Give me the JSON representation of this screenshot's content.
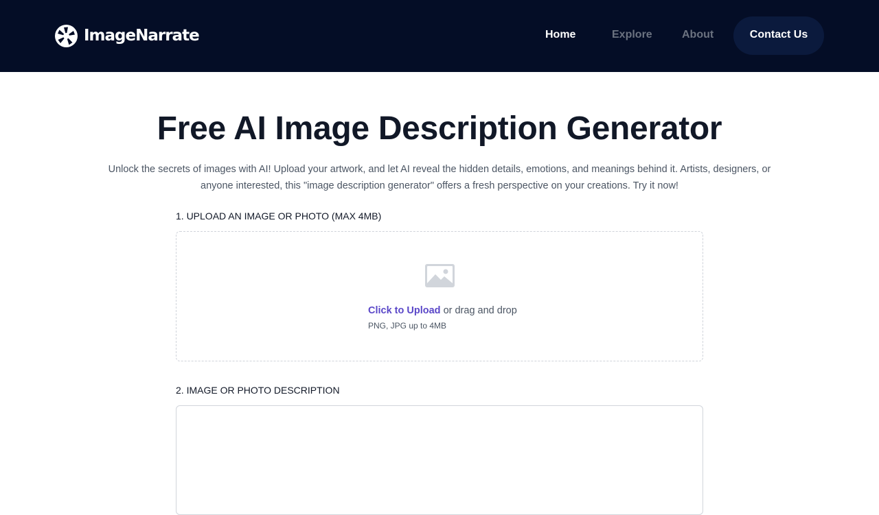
{
  "header": {
    "brand": "ImageNarrate",
    "nav": {
      "home": "Home",
      "explore": "Explore",
      "about": "About",
      "contact": "Contact Us"
    }
  },
  "main": {
    "title": "Free AI Image Description Generator",
    "subtitle": "Unlock the secrets of images with AI! Upload your artwork, and let AI reveal the hidden details, emotions, and meanings behind it. Artists, designers, or anyone interested, this \"image description generator\" offers a fresh perspective on your creations. Try it now!",
    "upload": {
      "label": "1. UPLOAD AN IMAGE OR PHOTO (MAX 4MB)",
      "link_text": "Click to Upload",
      "rest_text": " or drag and drop",
      "hint": "PNG, JPG up to 4MB",
      "icon": "photo-icon"
    },
    "description": {
      "label": "2. IMAGE OR PHOTO DESCRIPTION",
      "value": ""
    }
  },
  "colors": {
    "header_bg": "#040d26",
    "contact_bg": "#0b1a3d",
    "accent": "#5a47c8",
    "title": "#111827",
    "muted": "#4b5563"
  }
}
